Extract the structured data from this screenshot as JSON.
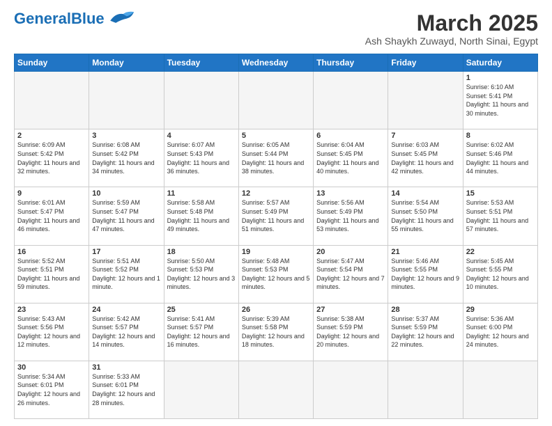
{
  "logo": {
    "text_general": "General",
    "text_blue": "Blue"
  },
  "header": {
    "month": "March 2025",
    "location": "Ash Shaykh Zuwayd, North Sinai, Egypt"
  },
  "days_of_week": [
    "Sunday",
    "Monday",
    "Tuesday",
    "Wednesday",
    "Thursday",
    "Friday",
    "Saturday"
  ],
  "weeks": [
    [
      {
        "day": "",
        "info": ""
      },
      {
        "day": "",
        "info": ""
      },
      {
        "day": "",
        "info": ""
      },
      {
        "day": "",
        "info": ""
      },
      {
        "day": "",
        "info": ""
      },
      {
        "day": "",
        "info": ""
      },
      {
        "day": "1",
        "info": "Sunrise: 6:10 AM\nSunset: 5:41 PM\nDaylight: 11 hours and 30 minutes."
      }
    ],
    [
      {
        "day": "2",
        "info": "Sunrise: 6:09 AM\nSunset: 5:42 PM\nDaylight: 11 hours and 32 minutes."
      },
      {
        "day": "3",
        "info": "Sunrise: 6:08 AM\nSunset: 5:42 PM\nDaylight: 11 hours and 34 minutes."
      },
      {
        "day": "4",
        "info": "Sunrise: 6:07 AM\nSunset: 5:43 PM\nDaylight: 11 hours and 36 minutes."
      },
      {
        "day": "5",
        "info": "Sunrise: 6:05 AM\nSunset: 5:44 PM\nDaylight: 11 hours and 38 minutes."
      },
      {
        "day": "6",
        "info": "Sunrise: 6:04 AM\nSunset: 5:45 PM\nDaylight: 11 hours and 40 minutes."
      },
      {
        "day": "7",
        "info": "Sunrise: 6:03 AM\nSunset: 5:45 PM\nDaylight: 11 hours and 42 minutes."
      },
      {
        "day": "8",
        "info": "Sunrise: 6:02 AM\nSunset: 5:46 PM\nDaylight: 11 hours and 44 minutes."
      }
    ],
    [
      {
        "day": "9",
        "info": "Sunrise: 6:01 AM\nSunset: 5:47 PM\nDaylight: 11 hours and 46 minutes."
      },
      {
        "day": "10",
        "info": "Sunrise: 5:59 AM\nSunset: 5:47 PM\nDaylight: 11 hours and 47 minutes."
      },
      {
        "day": "11",
        "info": "Sunrise: 5:58 AM\nSunset: 5:48 PM\nDaylight: 11 hours and 49 minutes."
      },
      {
        "day": "12",
        "info": "Sunrise: 5:57 AM\nSunset: 5:49 PM\nDaylight: 11 hours and 51 minutes."
      },
      {
        "day": "13",
        "info": "Sunrise: 5:56 AM\nSunset: 5:49 PM\nDaylight: 11 hours and 53 minutes."
      },
      {
        "day": "14",
        "info": "Sunrise: 5:54 AM\nSunset: 5:50 PM\nDaylight: 11 hours and 55 minutes."
      },
      {
        "day": "15",
        "info": "Sunrise: 5:53 AM\nSunset: 5:51 PM\nDaylight: 11 hours and 57 minutes."
      }
    ],
    [
      {
        "day": "16",
        "info": "Sunrise: 5:52 AM\nSunset: 5:51 PM\nDaylight: 11 hours and 59 minutes."
      },
      {
        "day": "17",
        "info": "Sunrise: 5:51 AM\nSunset: 5:52 PM\nDaylight: 12 hours and 1 minute."
      },
      {
        "day": "18",
        "info": "Sunrise: 5:50 AM\nSunset: 5:53 PM\nDaylight: 12 hours and 3 minutes."
      },
      {
        "day": "19",
        "info": "Sunrise: 5:48 AM\nSunset: 5:53 PM\nDaylight: 12 hours and 5 minutes."
      },
      {
        "day": "20",
        "info": "Sunrise: 5:47 AM\nSunset: 5:54 PM\nDaylight: 12 hours and 7 minutes."
      },
      {
        "day": "21",
        "info": "Sunrise: 5:46 AM\nSunset: 5:55 PM\nDaylight: 12 hours and 9 minutes."
      },
      {
        "day": "22",
        "info": "Sunrise: 5:45 AM\nSunset: 5:55 PM\nDaylight: 12 hours and 10 minutes."
      }
    ],
    [
      {
        "day": "23",
        "info": "Sunrise: 5:43 AM\nSunset: 5:56 PM\nDaylight: 12 hours and 12 minutes."
      },
      {
        "day": "24",
        "info": "Sunrise: 5:42 AM\nSunset: 5:57 PM\nDaylight: 12 hours and 14 minutes."
      },
      {
        "day": "25",
        "info": "Sunrise: 5:41 AM\nSunset: 5:57 PM\nDaylight: 12 hours and 16 minutes."
      },
      {
        "day": "26",
        "info": "Sunrise: 5:39 AM\nSunset: 5:58 PM\nDaylight: 12 hours and 18 minutes."
      },
      {
        "day": "27",
        "info": "Sunrise: 5:38 AM\nSunset: 5:59 PM\nDaylight: 12 hours and 20 minutes."
      },
      {
        "day": "28",
        "info": "Sunrise: 5:37 AM\nSunset: 5:59 PM\nDaylight: 12 hours and 22 minutes."
      },
      {
        "day": "29",
        "info": "Sunrise: 5:36 AM\nSunset: 6:00 PM\nDaylight: 12 hours and 24 minutes."
      }
    ],
    [
      {
        "day": "30",
        "info": "Sunrise: 5:34 AM\nSunset: 6:01 PM\nDaylight: 12 hours and 26 minutes."
      },
      {
        "day": "31",
        "info": "Sunrise: 5:33 AM\nSunset: 6:01 PM\nDaylight: 12 hours and 28 minutes."
      },
      {
        "day": "",
        "info": ""
      },
      {
        "day": "",
        "info": ""
      },
      {
        "day": "",
        "info": ""
      },
      {
        "day": "",
        "info": ""
      },
      {
        "day": "",
        "info": ""
      }
    ]
  ]
}
